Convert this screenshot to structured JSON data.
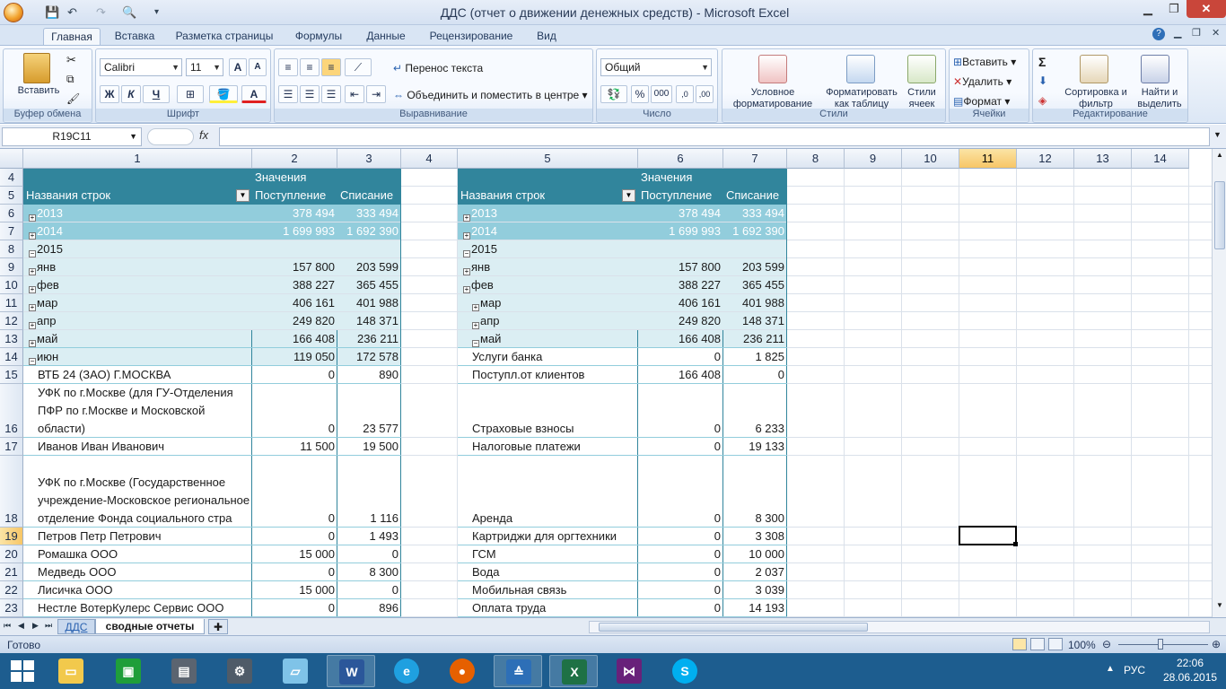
{
  "app": {
    "title": "ДДС (отчет о движении денежных средств) - Microsoft Excel"
  },
  "ribbon_tabs": [
    "Главная",
    "Вставка",
    "Разметка страницы",
    "Формулы",
    "Данные",
    "Рецензирование",
    "Вид"
  ],
  "ribbon": {
    "clipboard": {
      "paste": "Вставить",
      "label": "Буфер обмена"
    },
    "font": {
      "name": "Calibri",
      "size": "11",
      "label": "Шрифт",
      "bold": "Ж",
      "italic": "К",
      "underline": "Ч",
      "grow": "A",
      "shrink": "A",
      "color": "A"
    },
    "alignment": {
      "wrap": "Перенос текста",
      "merge": "Объединить и поместить в центре",
      "label": "Выравнивание"
    },
    "number": {
      "format": "Общий",
      "label": "Число",
      "percent": "%",
      "thousands": "000"
    },
    "styles": {
      "conditional": "Условное форматирование",
      "as_table": "Форматировать как таблицу",
      "cell_styles": "Стили ячеек",
      "label": "Стили"
    },
    "cells": {
      "insert": "Вставить",
      "delete": "Удалить",
      "format": "Формат",
      "label": "Ячейки"
    },
    "editing": {
      "sum": "Σ",
      "sort": "Сортировка и фильтр",
      "find": "Найти и выделить",
      "label": "Редактирование"
    }
  },
  "formula_bar": {
    "name_box": "R19C11",
    "fx": "fx",
    "formula": ""
  },
  "columns": [
    "1",
    "2",
    "3",
    "4",
    "5",
    "6",
    "7",
    "8",
    "9",
    "10",
    "11",
    "12",
    "13",
    "14"
  ],
  "rows": [
    "4",
    "5",
    "6",
    "7",
    "8",
    "9",
    "10",
    "11",
    "12",
    "13",
    "14",
    "15",
    "16",
    "17",
    "18",
    "19",
    "20",
    "21",
    "22",
    "23"
  ],
  "left_pivot": {
    "values_header": "Значения",
    "row_labels": "Названия строк",
    "col_in": "Поступление",
    "col_out": "Списание",
    "rows": [
      {
        "label": "2013",
        "in": "378 494",
        "out": "333 494"
      },
      {
        "label": "2014",
        "in": "1 699 993",
        "out": "1 692 390"
      },
      {
        "label": "2015",
        "in": "",
        "out": ""
      },
      {
        "label": "янв",
        "in": "157 800",
        "out": "203 599"
      },
      {
        "label": "фев",
        "in": "388 227",
        "out": "365 455"
      },
      {
        "label": "мар",
        "in": "406 161",
        "out": "401 988"
      },
      {
        "label": "апр",
        "in": "249 820",
        "out": "148 371"
      },
      {
        "label": "май",
        "in": "166 408",
        "out": "236 211"
      },
      {
        "label": "июн",
        "in": "119 050",
        "out": "172 578"
      },
      {
        "label": "ВТБ 24 (ЗАО) Г.МОСКВА",
        "in": "0",
        "out": "890"
      },
      {
        "label": "УФК по г.Москве (для ГУ-Отделения ПФР по г.Москве и Московской области)",
        "in": "0",
        "out": "23 577"
      },
      {
        "label": "Иванов Иван Иванович",
        "in": "11 500",
        "out": "19 500"
      },
      {
        "label": "УФК по г.Москве (Государственное учреждение-Московское региональное отделение Фонда социального стра",
        "in": "0",
        "out": "1 116"
      },
      {
        "label": "Петров Петр Петрович",
        "in": "0",
        "out": "1 493"
      },
      {
        "label": "Ромашка  ООО",
        "in": "15 000",
        "out": "0"
      },
      {
        "label": "Медведь ООО",
        "in": "0",
        "out": "8 300"
      },
      {
        "label": "Лисичка ООО",
        "in": "15 000",
        "out": "0"
      },
      {
        "label": "Нестле ВотерКулерс Сервис ООО",
        "in": "0",
        "out": "896"
      }
    ]
  },
  "right_pivot": {
    "values_header": "Значения",
    "row_labels": "Названия строк",
    "col_in": "Поступление",
    "col_out": "Списание",
    "rows": [
      {
        "label": "2013",
        "in": "378 494",
        "out": "333 494"
      },
      {
        "label": "2014",
        "in": "1 699 993",
        "out": "1 692 390"
      },
      {
        "label": "2015",
        "in": "",
        "out": ""
      },
      {
        "label": "янв",
        "in": "157 800",
        "out": "203 599"
      },
      {
        "label": "фев",
        "in": "388 227",
        "out": "365 455"
      },
      {
        "label": "мар",
        "in": "406 161",
        "out": "401 988"
      },
      {
        "label": "апр",
        "in": "249 820",
        "out": "148 371"
      },
      {
        "label": "май",
        "in": "166 408",
        "out": "236 211"
      },
      {
        "label": "Услуги банка",
        "in": "0",
        "out": "1 825"
      },
      {
        "label": "Поступл.от клиентов",
        "in": "166 408",
        "out": "0"
      },
      {
        "label": "Страховые взносы",
        "in": "0",
        "out": "6 233"
      },
      {
        "label": "Налоговые платежи",
        "in": "0",
        "out": "19 133"
      },
      {
        "label": "Аренда",
        "in": "0",
        "out": "8 300"
      },
      {
        "label": "Картриджи для оргтехники",
        "in": "0",
        "out": "3 308"
      },
      {
        "label": "ГСМ",
        "in": "0",
        "out": "10 000"
      },
      {
        "label": "Вода",
        "in": "0",
        "out": "2 037"
      },
      {
        "label": "Мобильная связь",
        "in": "0",
        "out": "3 039"
      },
      {
        "label": "Оплата труда",
        "in": "0",
        "out": "14 193"
      }
    ]
  },
  "sheets": [
    "ДДС",
    "сводные отчеты"
  ],
  "status": {
    "ready": "Готово",
    "zoom": "100%"
  },
  "taskbar": {
    "lang": "РУС",
    "time": "22:06",
    "date": "28.06.2015"
  },
  "colors": {
    "pivot_header": "#31859c",
    "pivot_year": "#92cddc",
    "pivot_month": "#dbeef3",
    "selected_header": "#f7c666"
  }
}
